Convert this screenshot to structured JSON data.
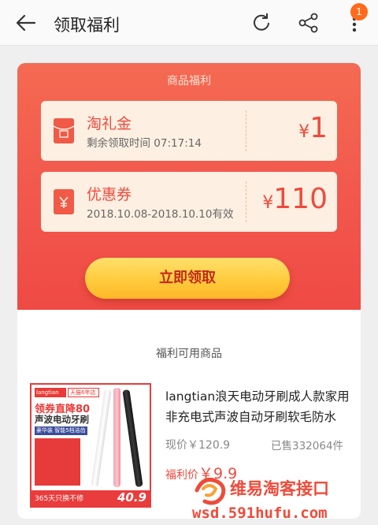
{
  "header": {
    "title": "领取福利",
    "back_icon": "back-arrow-icon",
    "refresh_icon": "refresh-icon",
    "share_icon": "share-icon",
    "more_icon": "more-vertical-icon",
    "badge_count": "1"
  },
  "benefits": {
    "section_title": "商品福利",
    "taolijin": {
      "name": "淘礼金",
      "subtitle": "剩余领取时间 07:17:14",
      "currency": "¥",
      "amount": "1",
      "icon": "red-envelope-icon"
    },
    "coupon": {
      "name": "优惠券",
      "subtitle": "2018.10.08-2018.10.10有效",
      "currency": "¥",
      "amount": "110",
      "icon": "coupon-icon"
    },
    "claim_button": "立即领取"
  },
  "products": {
    "section_title": "福利可用商品",
    "item": {
      "title": "langtian浪天电动牙刷成人款家用非充电式声波自动牙刷软毛防水",
      "current_price": "现价￥120.9",
      "sold": "已售332064件",
      "welfare_label": "福利价",
      "welfare_price": "￥9.9",
      "image": {
        "brand": "langtian",
        "store": "天猫6年店",
        "line1": "领券直降80",
        "line2": "声波电动牙刷",
        "line3": "豪华装 智能5档洁齿",
        "bottom_left": "365天只换不修",
        "bottom_right": "40.9"
      }
    }
  },
  "watermark": {
    "name": "维易淘客接口",
    "url": "wsd.591hufu.com"
  },
  "colors": {
    "accent": "#f04a3d",
    "button": "#ffc93a",
    "badge": "#ff6a1b"
  }
}
